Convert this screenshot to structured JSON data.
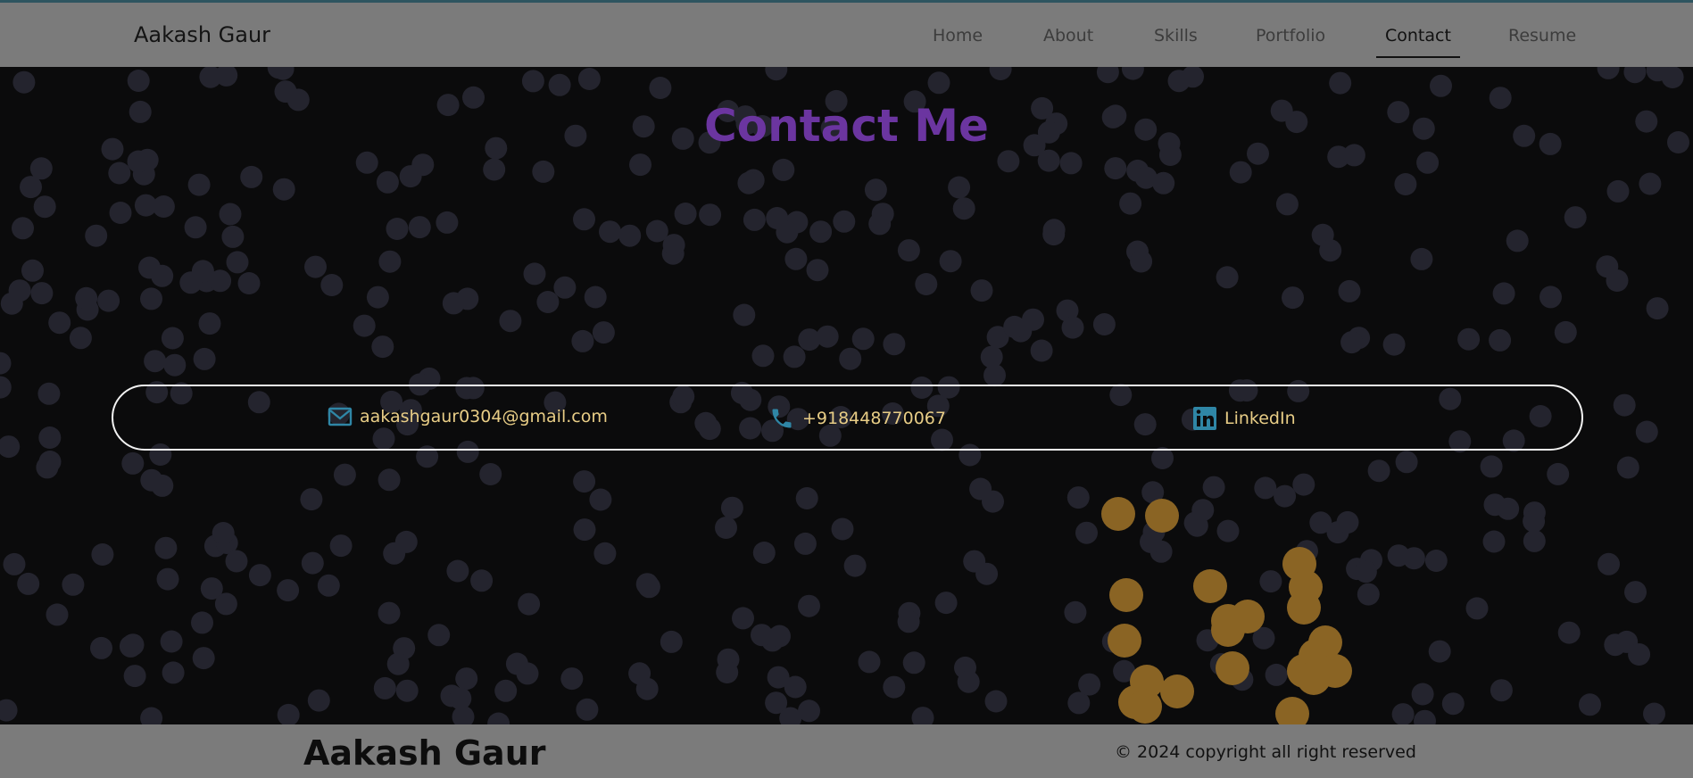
{
  "navbar": {
    "brand": "Aakash Gaur",
    "links": [
      {
        "label": "Home"
      },
      {
        "label": "About"
      },
      {
        "label": "Skills"
      },
      {
        "label": "Portfolio"
      },
      {
        "label": "Contact",
        "active": true
      },
      {
        "label": "Resume"
      }
    ]
  },
  "main": {
    "title": "Contact Me",
    "contacts": [
      {
        "icon": "mail-icon",
        "label": "aakashgaur0304@gmail.com"
      },
      {
        "icon": "phone-icon",
        "label": "+918448770067"
      },
      {
        "icon": "linkedin-icon",
        "label": "LinkedIn"
      }
    ]
  },
  "footer": {
    "name": "Aakash Gaur",
    "copyright": "© 2024 copyright all right reserved"
  },
  "colors": {
    "background": "#0b0b0c",
    "bar": "#7b7b7b",
    "title": "#6b35a0",
    "contact_text": "#e8cd86",
    "icon": "#2f86a6",
    "dot": "#24242e",
    "accent_dot": "#8a6424"
  }
}
